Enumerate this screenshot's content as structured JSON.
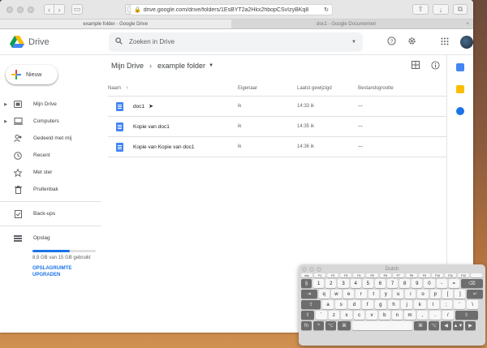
{
  "browser": {
    "url": "drive.google.com/drive/folders/1EsBYT2a2Hkx2hbopCSvIzyBKq8",
    "tabs": [
      "example folder - Google Drive",
      "doc1 - Google Documenten"
    ]
  },
  "header": {
    "app_name": "Drive",
    "search_placeholder": "Zoeken in Drive"
  },
  "sidebar": {
    "new_label": "Nieuw",
    "items": [
      {
        "label": "Mijn Drive",
        "icon": "drive-folder-icon",
        "caret": true
      },
      {
        "label": "Computers",
        "icon": "computer-icon",
        "caret": true
      },
      {
        "label": "Gedeeld met mij",
        "icon": "people-icon",
        "caret": false
      },
      {
        "label": "Recent",
        "icon": "clock-icon",
        "caret": false
      },
      {
        "label": "Met ster",
        "icon": "star-icon",
        "caret": false
      },
      {
        "label": "Prullenbak",
        "icon": "trash-icon",
        "caret": false
      }
    ],
    "backups_label": "Back-ups",
    "storage_label": "Opslag",
    "storage_used_fraction": 0.59,
    "storage_text": "8,9 GB van 15 GB gebruikt",
    "upgrade_label": "OPSLAGRUIMTE UPGRADEN"
  },
  "breadcrumb": {
    "root": "Mijn Drive",
    "current": "example folder"
  },
  "table": {
    "columns": [
      "Naam",
      "Eigenaar",
      "Laatst gewijzigd",
      "Bestandsgrootte"
    ],
    "rows": [
      {
        "name": "doc1",
        "owner": "ik",
        "modified": "14:33 ik",
        "size": "—"
      },
      {
        "name": "Kopie van doc1",
        "owner": "ik",
        "modified": "14:35 ik",
        "size": "—"
      },
      {
        "name": "Kopie van Kopie van doc1",
        "owner": "ik",
        "modified": "14:36 ik",
        "size": "—"
      }
    ]
  },
  "keyboard": {
    "title": "Dutch",
    "row_fn": [
      "esc",
      "F1",
      "F2",
      "F3",
      "F4",
      "F5",
      "F6",
      "F7",
      "F8",
      "F9",
      "F10",
      "F11",
      "F12",
      ""
    ],
    "row1": [
      "§",
      "1",
      "2",
      "3",
      "4",
      "5",
      "6",
      "7",
      "8",
      "9",
      "0",
      "-",
      "=",
      "⌫"
    ],
    "row2": [
      "⇥",
      "q",
      "w",
      "e",
      "r",
      "t",
      "y",
      "u",
      "i",
      "o",
      "p",
      "[",
      "]",
      "↵"
    ],
    "row3": [
      "⇪",
      "a",
      "s",
      "d",
      "f",
      "g",
      "h",
      "j",
      "k",
      "l",
      ";",
      "'",
      "\\"
    ],
    "row4": [
      "⇧",
      "`",
      "z",
      "x",
      "c",
      "v",
      "b",
      "n",
      "m",
      ",",
      ".",
      "/",
      "⇧"
    ],
    "row5": [
      "fn",
      "^",
      "⌥",
      "⌘",
      "",
      "⌘",
      "⌥",
      "◀",
      "▲▼",
      "▶"
    ]
  },
  "colors": {
    "accent": "#1a73e8",
    "doc_blue": "#4285f4"
  }
}
